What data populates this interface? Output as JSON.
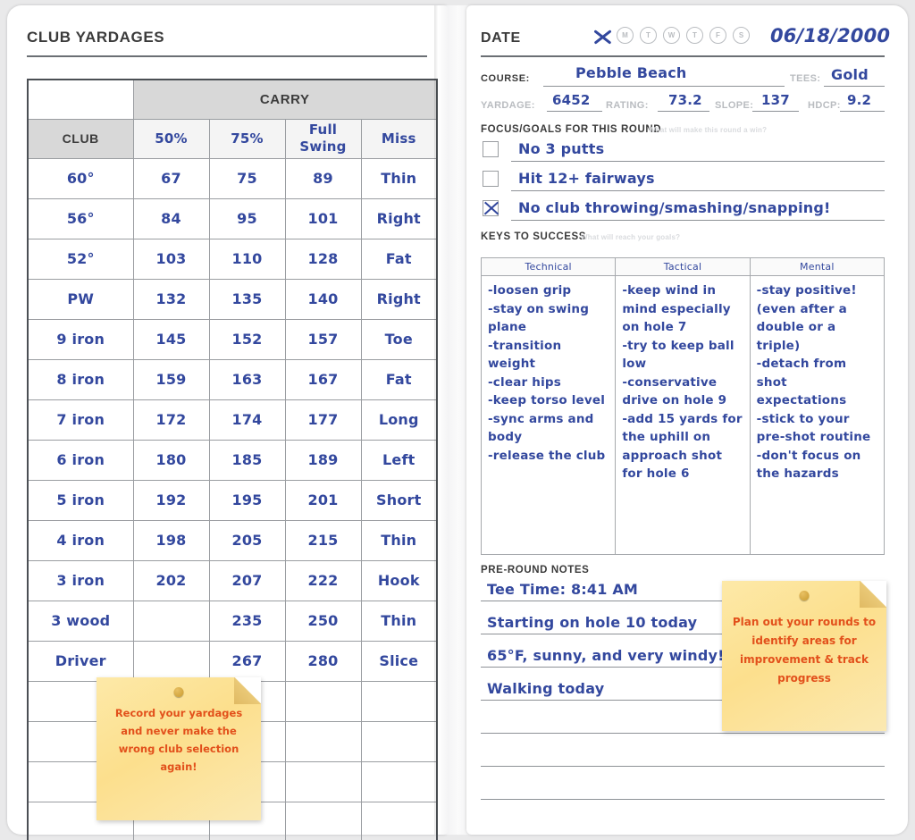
{
  "left_page": {
    "title": "CLUB YARDAGES",
    "table": {
      "group_header": "CARRY",
      "columns": [
        "CLUB",
        "50%",
        "75%",
        "Full Swing",
        "Miss"
      ],
      "rows": [
        {
          "club": "60°",
          "p50": "67",
          "p75": "75",
          "full": "89",
          "miss": "Thin"
        },
        {
          "club": "56°",
          "p50": "84",
          "p75": "95",
          "full": "101",
          "miss": "Right"
        },
        {
          "club": "52°",
          "p50": "103",
          "p75": "110",
          "full": "128",
          "miss": "Fat"
        },
        {
          "club": "PW",
          "p50": "132",
          "p75": "135",
          "full": "140",
          "miss": "Right"
        },
        {
          "club": "9 iron",
          "p50": "145",
          "p75": "152",
          "full": "157",
          "miss": "Toe"
        },
        {
          "club": "8 iron",
          "p50": "159",
          "p75": "163",
          "full": "167",
          "miss": "Fat"
        },
        {
          "club": "7 iron",
          "p50": "172",
          "p75": "174",
          "full": "177",
          "miss": "Long"
        },
        {
          "club": "6 iron",
          "p50": "180",
          "p75": "185",
          "full": "189",
          "miss": "Left"
        },
        {
          "club": "5 iron",
          "p50": "192",
          "p75": "195",
          "full": "201",
          "miss": "Short"
        },
        {
          "club": "4 iron",
          "p50": "198",
          "p75": "205",
          "full": "215",
          "miss": "Thin"
        },
        {
          "club": "3 iron",
          "p50": "202",
          "p75": "207",
          "full": "222",
          "miss": "Hook"
        },
        {
          "club": "3 wood",
          "p50": "",
          "p75": "235",
          "full": "250",
          "miss": "Thin"
        },
        {
          "club": "Driver",
          "p50": "",
          "p75": "267",
          "full": "280",
          "miss": "Slice"
        },
        {
          "club": "",
          "p50": "",
          "p75": "",
          "full": "",
          "miss": ""
        },
        {
          "club": "",
          "p50": "",
          "p75": "",
          "full": "",
          "miss": ""
        },
        {
          "club": "",
          "p50": "",
          "p75": "",
          "full": "",
          "miss": ""
        },
        {
          "club": "",
          "p50": "",
          "p75": "",
          "full": "",
          "miss": ""
        }
      ]
    },
    "sticky_note": "Record your yardages and never make the wrong club selection again!"
  },
  "right_page": {
    "date_label": "DATE",
    "days": [
      "S",
      "M",
      "T",
      "W",
      "T",
      "F",
      "S"
    ],
    "day_selected_index": 0,
    "date_value": "06/18/2000",
    "course": {
      "course_label": "COURSE:",
      "course_value": "Pebble Beach",
      "tees_label": "TEES:",
      "tees_value": "Gold",
      "yardage_label": "YARDAGE:",
      "yardage_value": "6452",
      "rating_label": "RATING:",
      "rating_value": "73.2",
      "slope_label": "SLOPE:",
      "slope_value": "137",
      "hdcp_label": "HDCP:",
      "hdcp_value": "9.2"
    },
    "focus": {
      "title": "FOCUS/GOALS FOR THIS ROUND",
      "hint": "What will make this round a win?",
      "goals": [
        {
          "text": "No 3 putts",
          "checked": false
        },
        {
          "text": "Hit 12+ fairways",
          "checked": false
        },
        {
          "text": "No club throwing/smashing/snapping!",
          "checked": true
        }
      ]
    },
    "keys": {
      "title": "KEYS TO SUCCESS",
      "hint": "What will reach your goals?",
      "columns": [
        {
          "header": "Technical",
          "body": "-loosen grip\n-stay on swing plane\n-transition weight\n-clear hips\n-keep torso level\n-sync arms and body\n-release the club"
        },
        {
          "header": "Tactical",
          "body": "-keep wind in mind especially on hole 7\n-try to keep ball low\n-conservative drive on hole 9\n-add 15 yards for the uphill on approach shot for hole 6"
        },
        {
          "header": "Mental",
          "body": "-stay positive! (even after a double or a triple)\n-detach from shot expectations\n-stick to your pre-shot routine\n-don't focus on the hazards"
        }
      ]
    },
    "pre_round": {
      "title": "PRE-ROUND NOTES",
      "lines": [
        "Tee Time: 8:41 AM",
        "Starting on hole 10 today",
        "65°F, sunny, and very windy!",
        "Walking today",
        "",
        "",
        ""
      ]
    },
    "sticky_note": "Plan out your rounds to identify areas for improvement & track progress"
  },
  "colors": {
    "ink_blue": "#33489e",
    "sticky_yellow": "#fcdf8d",
    "sticky_ink": "#e2501b",
    "header_gray": "#d8d8d8",
    "page_bg": "#ffffff"
  }
}
